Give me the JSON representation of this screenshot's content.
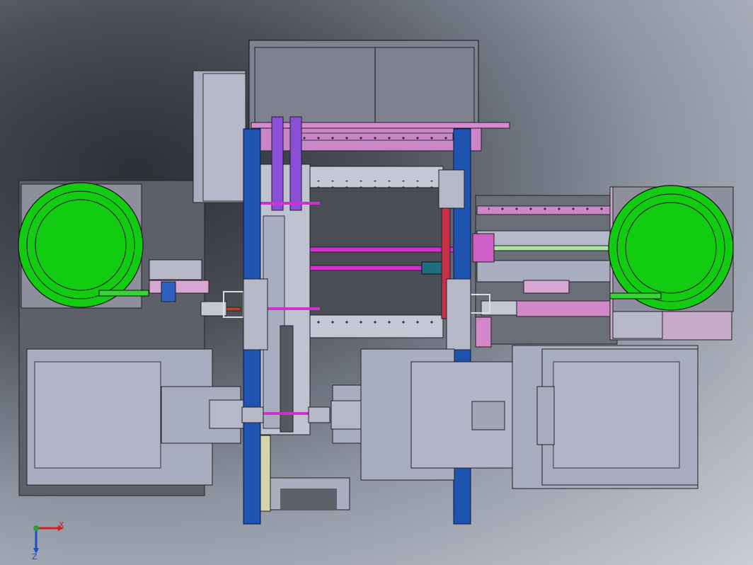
{
  "viewport": {
    "background": "gradient-grey",
    "triad": {
      "x_label": "X",
      "z_label": "Z"
    }
  },
  "colors": {
    "frame_blue": "#1f53b0",
    "feeder_green": "#11cc11",
    "bar_purple": "#8a4fd6",
    "plate_pink": "#d48bd0",
    "rod_magenta": "#d030d0",
    "steel_grey": "#b4b8c8",
    "dark_plate": "#5d6068",
    "housing_grey": "#7e8290"
  },
  "icons": [
    "coordinate-triad-icon"
  ]
}
